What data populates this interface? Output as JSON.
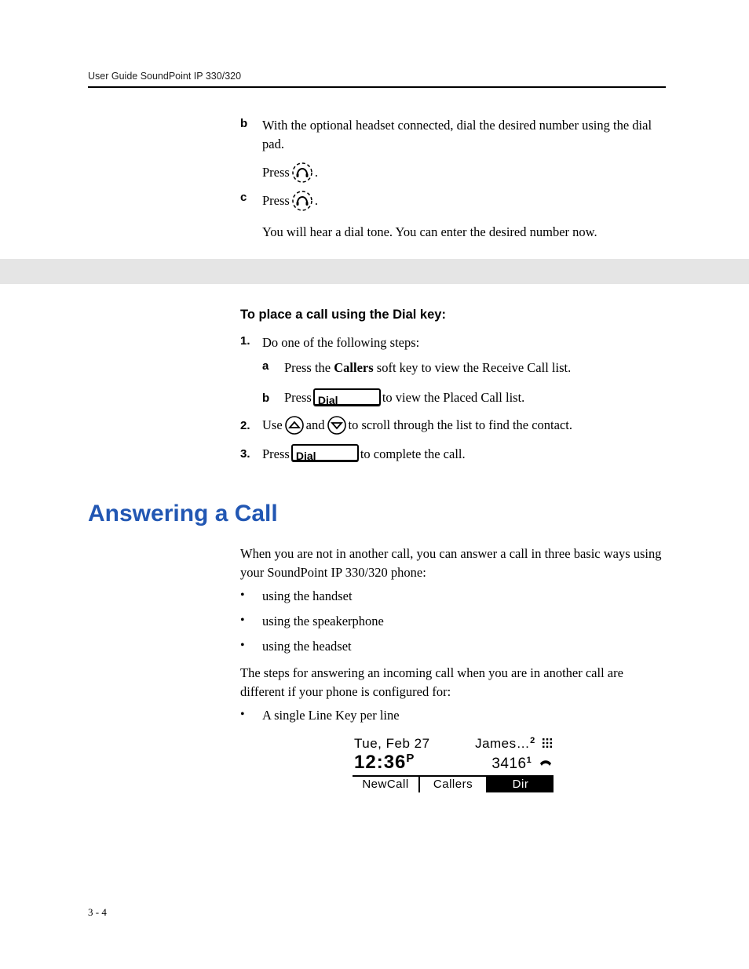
{
  "running_head": "User Guide SoundPoint IP 330/320",
  "section_b": {
    "marker": "b",
    "text": "With the optional headset connected, dial the desired number using the dial pad.",
    "press": "Press",
    "period": "."
  },
  "section_c": {
    "marker": "c",
    "press": "Press",
    "period": ".",
    "followup": "You will hear a dial tone. You can enter the desired number now."
  },
  "dial_key_heading": "To place a call using the Dial key:",
  "step1": {
    "marker": "1.",
    "text": "Do one of the following steps:",
    "a": {
      "marker": "a",
      "pre": "Press the ",
      "bold": "Callers",
      "post": " soft key to view the Receive Call list."
    },
    "b": {
      "marker": "b",
      "pre": "Press ",
      "post": " to view the Placed Call list."
    }
  },
  "step2": {
    "marker": "2.",
    "pre": "Use ",
    "mid": " and ",
    "post": " to scroll through the list to find the contact."
  },
  "step3": {
    "marker": "3.",
    "pre": "Press ",
    "post": " to complete the call."
  },
  "dial_button_label": "Dial",
  "answering_heading": "Answering a Call",
  "answering_intro": "When you are not in another call, you can answer a call in three basic ways using your SoundPoint IP 330/320 phone:",
  "answer_bullets": [
    "using the handset",
    "using the speakerphone",
    "using the headset"
  ],
  "answering_followup": "The steps for answering an incoming call when you are in another call are different if your phone is configured for:",
  "config_bullets": [
    "A single Line Key per line"
  ],
  "lcd": {
    "date": "Tue, Feb 27",
    "who": "James…",
    "who_badge": "2",
    "time": "12:36",
    "ampm": "P",
    "ext": "3416",
    "ext_badge": "1",
    "softkeys": [
      "NewCall",
      "Callers",
      "Dir"
    ],
    "selected_index": 2
  },
  "page_number": "3 - 4"
}
